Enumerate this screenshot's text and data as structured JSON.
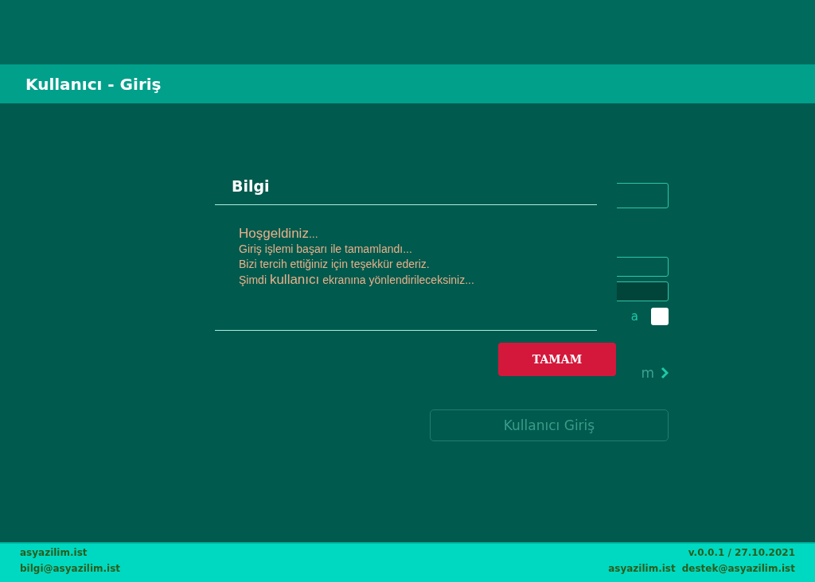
{
  "header": {
    "title": "Kullanıcı - Giriş"
  },
  "form": {
    "remember_label": "a",
    "remember_checked": false,
    "link_label": "m",
    "submit": "Kullanıcı Giriş",
    "submit_disabled": true
  },
  "dialog": {
    "title": "Bilgi",
    "lines": [
      "**Hoşgeldiniz**...",
      "Giriş işlemi başarı ile tamamlandı...",
      "Bizi tercih ettiğiniz için teşekkür ederiz.",
      "Şimdi **kullanıcı** ekranına yönlendirileceksiniz..."
    ],
    "button": "TAMAM"
  },
  "footer": {
    "left": [
      "asyazilim.ist",
      "bilgi@asyazilim.ist"
    ],
    "version": "v.0.0.1 / 27.10.2021",
    "right": [
      "asyazilim.ist",
      "destek@asyazilim.ist"
    ]
  }
}
